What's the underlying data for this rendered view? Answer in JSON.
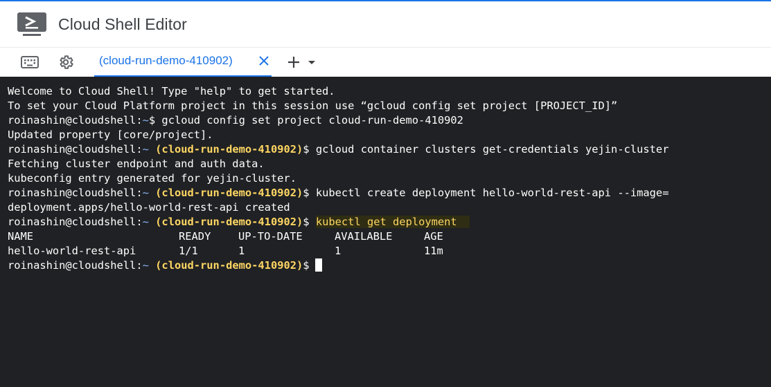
{
  "app": {
    "title": "Cloud Shell Editor"
  },
  "tabbar": {
    "keyboard_icon": "keyboard-icon",
    "settings_icon": "gear-icon",
    "active_tab": {
      "label": "(cloud-run-demo-410902)"
    },
    "add_icon": "plus-icon",
    "dropdown_icon": "caret-down-icon"
  },
  "terminal": {
    "welcome_line_1": "Welcome to Cloud Shell! Type \"help\" to get started.",
    "welcome_line_2": "To set your Cloud Platform project in this session use “gcloud config set project [PROJECT_ID]”",
    "prompt_user": "roinashin@cloudshell:",
    "prompt_tilde": "~",
    "prompt_project": "(cloud-run-demo-410902)",
    "prompt_symbol": "$",
    "cmd_1": " gcloud config set project cloud-run-demo-410902",
    "out_1": "Updated property [core/project].",
    "cmd_2": " gcloud container clusters get-credentials yejin-cluster",
    "out_2a": "Fetching cluster endpoint and auth data.",
    "out_2b": "kubeconfig entry generated for yejin-cluster.",
    "cmd_3": " kubectl create deployment hello-world-rest-api --image=",
    "out_3": "deployment.apps/hello-world-rest-api created",
    "cmd_4": "kubectl get deployment",
    "table": {
      "headers": [
        "NAME",
        "READY",
        "UP-TO-DATE",
        "AVAILABLE",
        "AGE"
      ],
      "row": [
        "hello-world-rest-api",
        "1/1",
        "1",
        "1",
        "11m"
      ]
    }
  },
  "colors": {
    "accent": "#1a73e8",
    "terminal_bg": "#202124",
    "prompt_project": "#fdd663",
    "prompt_tilde": "#8ab4f8"
  }
}
